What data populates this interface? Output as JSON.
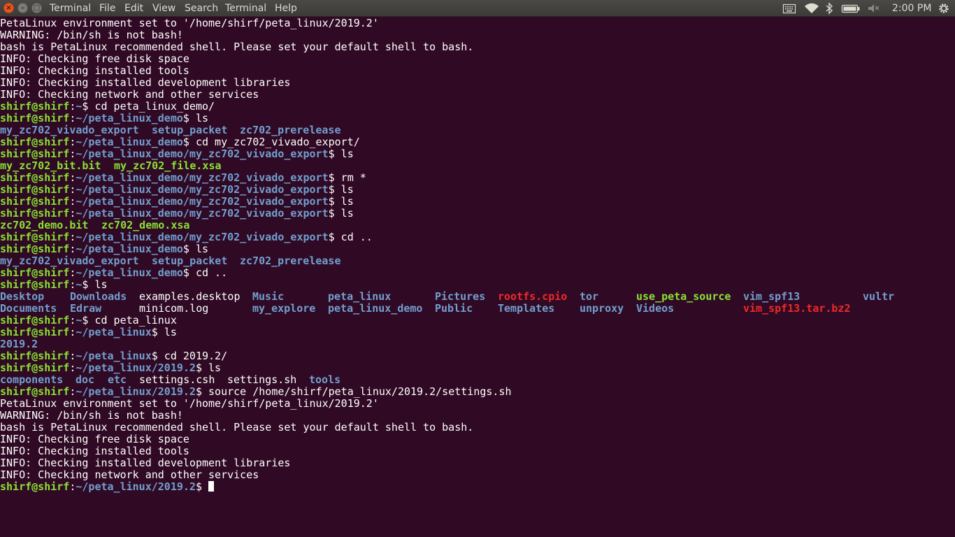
{
  "topbar": {
    "menus": [
      "Terminal",
      "File",
      "Edit",
      "View",
      "Search",
      "Terminal",
      "Help"
    ],
    "clock": "2:00 PM",
    "tray_icons": [
      "keyboard-icon",
      "wifi-icon",
      "bluetooth-icon",
      "battery-icon",
      "volume-muted-icon",
      "settings-gear-icon"
    ]
  },
  "terminal": {
    "block1": [
      "PetaLinux environment set to '/home/shirf/peta_linux/2019.2'",
      "WARNING: /bin/sh is not bash!",
      "bash is PetaLinux recommended shell. Please set your default shell to bash.",
      "INFO: Checking free disk space",
      "INFO: Checking installed tools",
      "INFO: Checking installed development libraries",
      "INFO: Checking network and other services"
    ],
    "user": "shirf@shirf",
    "colon": ":",
    "dollar": "$ ",
    "sessions": [
      {
        "path": "~",
        "cmd": "cd peta_linux_demo/"
      },
      {
        "path": "~/peta_linux_demo",
        "cmd": "ls"
      },
      {
        "path": "~/peta_linux_demo",
        "cmd": "cd my_zc702_vivado_export/"
      },
      {
        "path": "~/peta_linux_demo/my_zc702_vivado_export",
        "cmd": "ls"
      },
      {
        "path": "~/peta_linux_demo/my_zc702_vivado_export",
        "cmd": "rm *"
      },
      {
        "path": "~/peta_linux_demo/my_zc702_vivado_export",
        "cmd": "ls"
      },
      {
        "path": "~/peta_linux_demo/my_zc702_vivado_export",
        "cmd": "ls"
      },
      {
        "path": "~/peta_linux_demo/my_zc702_vivado_export",
        "cmd": "ls"
      },
      {
        "path": "~/peta_linux_demo/my_zc702_vivado_export",
        "cmd": "cd .."
      },
      {
        "path": "~/peta_linux_demo",
        "cmd": "ls"
      },
      {
        "path": "~/peta_linux_demo",
        "cmd": "cd .."
      },
      {
        "path": "~",
        "cmd": "ls"
      },
      {
        "path": "~",
        "cmd": "cd peta_linux"
      },
      {
        "path": "~/peta_linux",
        "cmd": "ls"
      },
      {
        "path": "~/peta_linux",
        "cmd": "cd 2019.2/"
      },
      {
        "path": "~/peta_linux/2019.2",
        "cmd": "ls"
      },
      {
        "path": "~/peta_linux/2019.2",
        "cmd": "source /home/shirf/peta_linux/2019.2/settings.sh"
      },
      {
        "path": "~/peta_linux/2019.2",
        "cmd": ""
      }
    ],
    "ls_demo": [
      "my_zc702_vivado_export",
      "setup_packet",
      "zc702_prerelease"
    ],
    "ls_export1": [
      "my_zc702_bit.bit",
      "my_zc702_file.xsa"
    ],
    "ls_export2": [
      "zc702_demo.bit",
      "zc702_demo.xsa"
    ],
    "ls_home_row1": [
      "Desktop",
      "Downloads",
      "examples.desktop",
      "Music",
      "peta_linux",
      "Pictures",
      "rootfs.cpio",
      "tor",
      "use_peta_source",
      "vim_spf13",
      "vultr"
    ],
    "ls_home_row2": [
      "Documents",
      "Edraw",
      "minicom.log",
      "my_explore",
      "peta_linux_demo",
      "Public",
      "Templates",
      "unproxy",
      "Videos",
      "vim_spf13.tar.bz2"
    ],
    "ls_petalinux": [
      "2019.2"
    ],
    "ls_2019": [
      "components",
      "doc",
      "etc",
      "settings.csh",
      "settings.sh",
      "tools"
    ],
    "block2": [
      "PetaLinux environment set to '/home/shirf/peta_linux/2019.2'",
      "WARNING: /bin/sh is not bash!",
      "bash is PetaLinux recommended shell. Please set your default shell to bash.",
      "INFO: Checking free disk space",
      "INFO: Checking installed tools",
      "INFO: Checking installed development libraries",
      "INFO: Checking network and other services"
    ]
  },
  "colors": {
    "background": "#300a24",
    "user_prompt": "#8ae234",
    "path_prompt": "#729fcf",
    "archive": "#ef2929",
    "topbar": "#3c3b37"
  }
}
